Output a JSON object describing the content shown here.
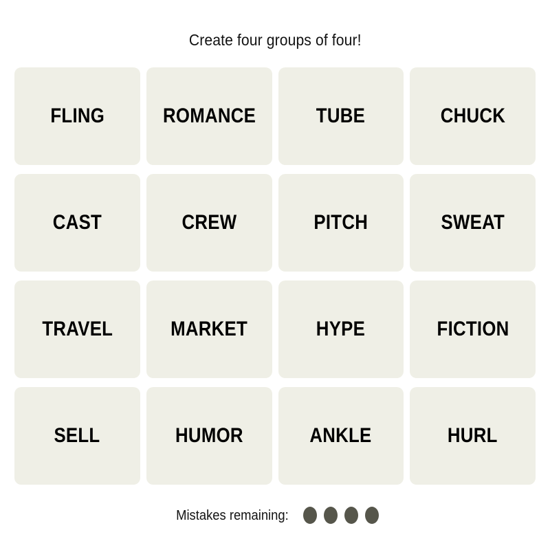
{
  "page": {
    "title": "Create four groups of four!",
    "background_color": "#ffffff"
  },
  "board": {
    "tile_color": "#efefe6",
    "tile_text_color": "#000000",
    "rows": [
      [
        "FLING",
        "ROMANCE",
        "TUBE",
        "CHUCK"
      ],
      [
        "CAST",
        "CREW",
        "PITCH",
        "SWEAT"
      ],
      [
        "TRAVEL",
        "MARKET",
        "HYPE",
        "FICTION"
      ],
      [
        "SELL",
        "HUMOR",
        "ANKLE",
        "HURL"
      ]
    ],
    "tiles": [
      "FLING",
      "ROMANCE",
      "TUBE",
      "CHUCK",
      "CAST",
      "CREW",
      "PITCH",
      "SWEAT",
      "TRAVEL",
      "MARKET",
      "HYPE",
      "FICTION",
      "SELL",
      "HUMOR",
      "ANKLE",
      "HURL"
    ]
  },
  "footer": {
    "mistakes_label": "Mistakes remaining:",
    "mistakes_count": 4,
    "dot_color": "#56564b"
  }
}
